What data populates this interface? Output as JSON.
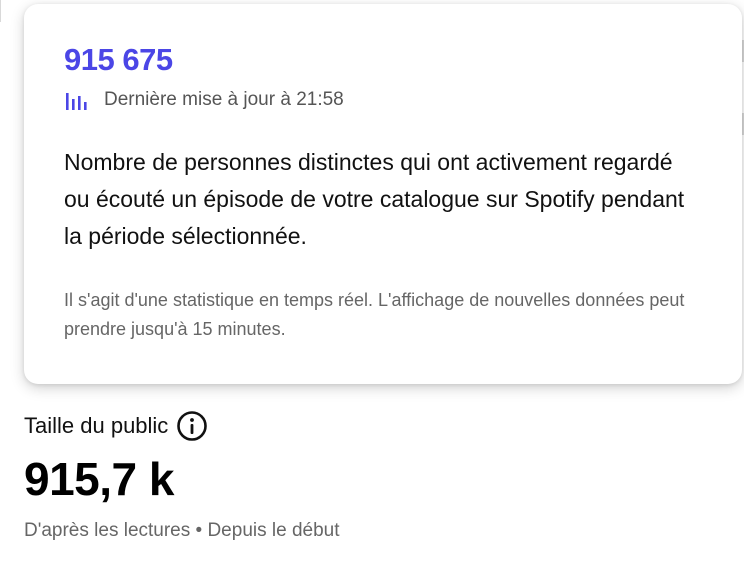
{
  "tooltip": {
    "value": "915 675",
    "updated": "Dernière mise à jour à 21:58",
    "description": "Nombre de personnes distinctes qui ont activement regardé ou écouté un épisode de votre catalogue sur Spotify pendant la période sélectionnée.",
    "note": "Il s'agit d'une statistique en temps réel. L'affichage de nouvelles données peut prendre jusqu'à 15 minutes.",
    "icon": "bar-chart-icon"
  },
  "metric": {
    "label": "Taille du public",
    "value": "915,7 k",
    "subtitle": "D'après les lectures • Depuis le début",
    "info_icon": "info-icon"
  },
  "colors": {
    "accent": "#4b46e6",
    "muted_text": "#666666",
    "primary_text": "#111111"
  }
}
